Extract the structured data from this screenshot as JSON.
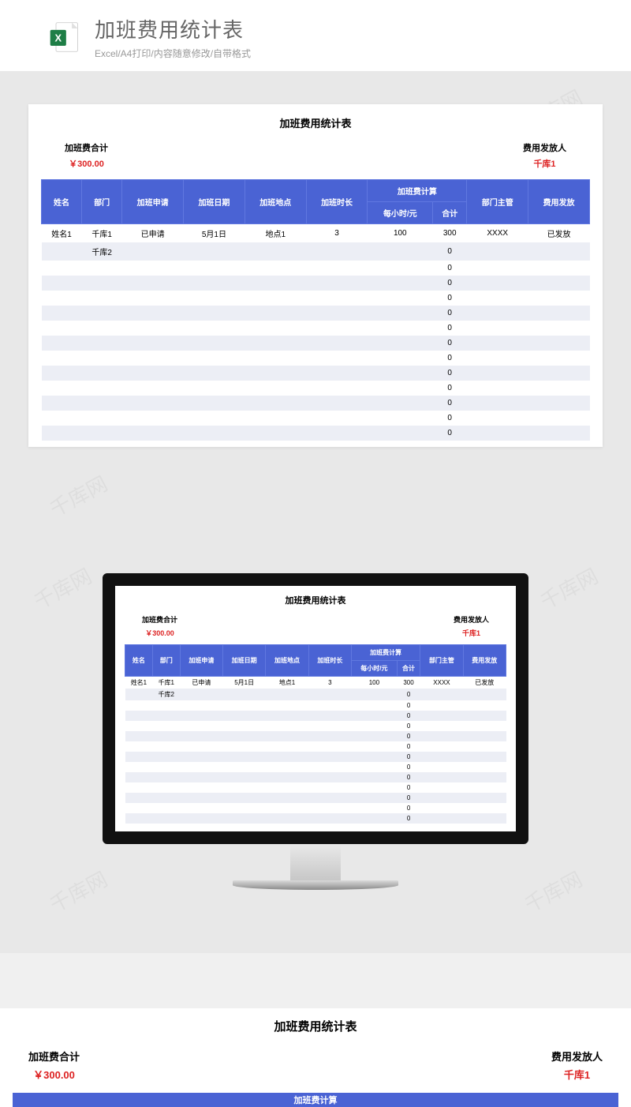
{
  "header": {
    "title": "加班费用统计表",
    "subtitle": "Excel/A4打印/内容随意修改/自带格式"
  },
  "watermark": "千库网",
  "sheet": {
    "title": "加班费用统计表",
    "summary_left_label": "加班费合计",
    "summary_left_value": "￥300.00",
    "summary_right_label": "费用发放人",
    "summary_right_value": "千库1",
    "columns": {
      "c1": "姓名",
      "c2": "部门",
      "c3": "加班申请",
      "c4": "加班日期",
      "c5": "加班地点",
      "c6": "加班时长",
      "group": "加班费计算",
      "c7": "每小时/元",
      "c8": "合计",
      "c9": "部门主管",
      "c10": "费用发放"
    },
    "rows": [
      {
        "name": "姓名1",
        "dept": "千库1",
        "apply": "已申请",
        "date": "5月1日",
        "place": "地点1",
        "hours": "3",
        "rate": "100",
        "total": "300",
        "mgr": "XXXX",
        "paid": "已发放"
      },
      {
        "name": "",
        "dept": "千库2",
        "apply": "",
        "date": "",
        "place": "",
        "hours": "",
        "rate": "",
        "total": "0",
        "mgr": "",
        "paid": ""
      },
      {
        "name": "",
        "dept": "",
        "apply": "",
        "date": "",
        "place": "",
        "hours": "",
        "rate": "",
        "total": "0",
        "mgr": "",
        "paid": ""
      },
      {
        "name": "",
        "dept": "",
        "apply": "",
        "date": "",
        "place": "",
        "hours": "",
        "rate": "",
        "total": "0",
        "mgr": "",
        "paid": ""
      },
      {
        "name": "",
        "dept": "",
        "apply": "",
        "date": "",
        "place": "",
        "hours": "",
        "rate": "",
        "total": "0",
        "mgr": "",
        "paid": ""
      },
      {
        "name": "",
        "dept": "",
        "apply": "",
        "date": "",
        "place": "",
        "hours": "",
        "rate": "",
        "total": "0",
        "mgr": "",
        "paid": ""
      },
      {
        "name": "",
        "dept": "",
        "apply": "",
        "date": "",
        "place": "",
        "hours": "",
        "rate": "",
        "total": "0",
        "mgr": "",
        "paid": ""
      },
      {
        "name": "",
        "dept": "",
        "apply": "",
        "date": "",
        "place": "",
        "hours": "",
        "rate": "",
        "total": "0",
        "mgr": "",
        "paid": ""
      },
      {
        "name": "",
        "dept": "",
        "apply": "",
        "date": "",
        "place": "",
        "hours": "",
        "rate": "",
        "total": "0",
        "mgr": "",
        "paid": ""
      },
      {
        "name": "",
        "dept": "",
        "apply": "",
        "date": "",
        "place": "",
        "hours": "",
        "rate": "",
        "total": "0",
        "mgr": "",
        "paid": ""
      },
      {
        "name": "",
        "dept": "",
        "apply": "",
        "date": "",
        "place": "",
        "hours": "",
        "rate": "",
        "total": "0",
        "mgr": "",
        "paid": ""
      },
      {
        "name": "",
        "dept": "",
        "apply": "",
        "date": "",
        "place": "",
        "hours": "",
        "rate": "",
        "total": "0",
        "mgr": "",
        "paid": ""
      },
      {
        "name": "",
        "dept": "",
        "apply": "",
        "date": "",
        "place": "",
        "hours": "",
        "rate": "",
        "total": "0",
        "mgr": "",
        "paid": ""
      },
      {
        "name": "",
        "dept": "",
        "apply": "",
        "date": "",
        "place": "",
        "hours": "",
        "rate": "",
        "total": "0",
        "mgr": "",
        "paid": ""
      }
    ]
  }
}
